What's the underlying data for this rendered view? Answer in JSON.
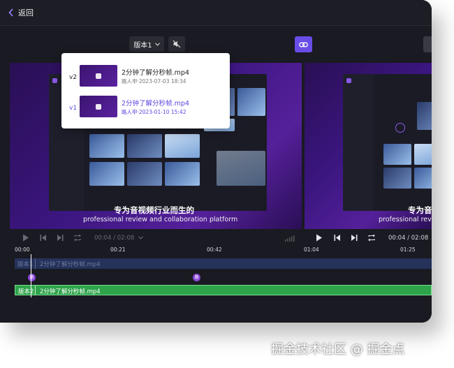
{
  "topbar": {
    "back_label": "返回"
  },
  "toolbar": {
    "version_label": "版本1"
  },
  "left_video": {
    "subtitle_cn": "专为音视频行业而生的",
    "subtitle_en": "professional review and collaboration platform",
    "timecode": "00:04 / 02:08"
  },
  "right_video": {
    "subtitle_cn": "专为音视",
    "subtitle_en": "professional review",
    "timecode": "00:04 / 02:08"
  },
  "timeline": {
    "ticks": [
      "00:00",
      "00:21",
      "00:42",
      "01:04",
      "01:25"
    ],
    "track_ghost": {
      "label": "版本1",
      "name": "2分钟了解分秒帧.mp4"
    },
    "track_active": {
      "label": "版本2",
      "name": "2分钟了解分秒帧.mp4"
    },
    "marker_label": "路"
  },
  "popup": {
    "items": [
      {
        "version": "v2",
        "title": "2分钟了解分秒帧.mp4",
        "meta": "路人甲·2023-07-03 18:34"
      },
      {
        "version": "v1",
        "title": "2分钟了解分秒帧.mp4",
        "meta": "路人甲·2023-01-10 15:42"
      }
    ]
  },
  "watermark": "掘金技术社区 @ 掘金点",
  "colors": {
    "accent": "#6a4de8",
    "active_track": "#2ea34a",
    "popup_active": "#5b46e0"
  }
}
